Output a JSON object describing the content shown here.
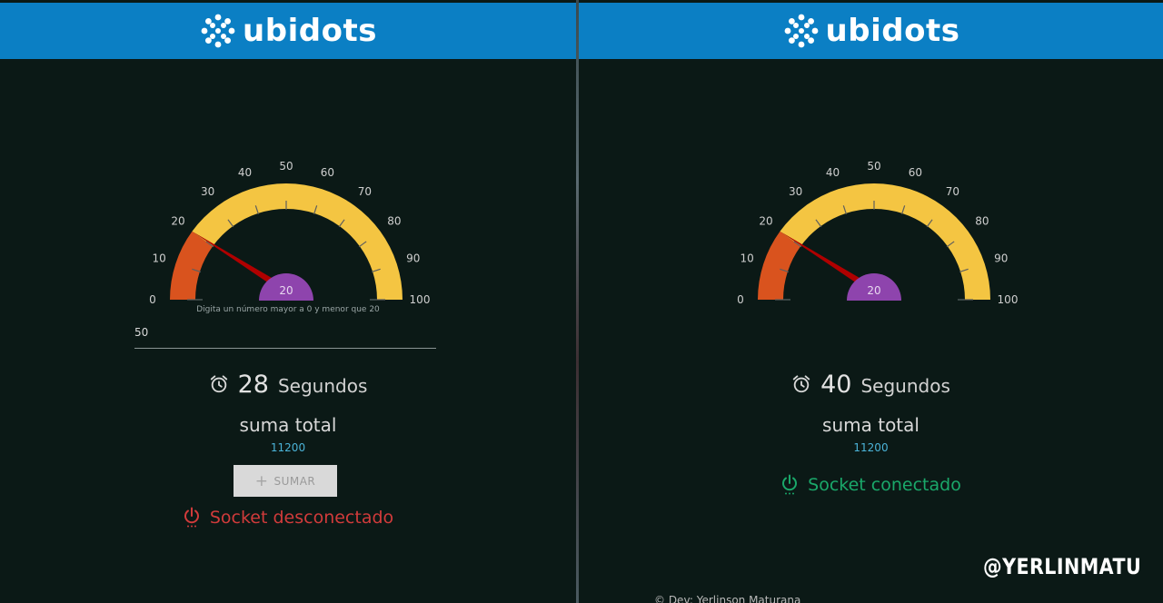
{
  "brand": {
    "name": "ubidots"
  },
  "colors": {
    "header_bg": "#0b7fc4",
    "page_bg": "#0b1916",
    "gauge_low": "#d9531e",
    "gauge_high": "#f4c542",
    "needle": "#b00000",
    "center_hub": "#8e44ad",
    "disconnected": "#d13b3b",
    "connected": "#1aa86a",
    "value_link": "#4bb3d8"
  },
  "gauge_ticks": [
    "0",
    "10",
    "20",
    "30",
    "40",
    "50",
    "60",
    "70",
    "80",
    "90",
    "100"
  ],
  "left": {
    "gauge": {
      "min": 0,
      "max": 100,
      "value": 20,
      "value_label": "20",
      "threshold": 20
    },
    "hint": "Digita un número mayor a 0 y menor que 20",
    "input_value": "50",
    "timer": {
      "icon": "alarm-clock-icon",
      "count": "28",
      "unit": "Segundos"
    },
    "suma_label": "suma total",
    "suma_value": "11200",
    "button": {
      "icon": "+",
      "label": "SUMAR"
    },
    "status": {
      "icon": "power-icon",
      "text": "Socket desconectado"
    }
  },
  "right": {
    "gauge": {
      "min": 0,
      "max": 100,
      "value": 20,
      "value_label": "20",
      "threshold": 20
    },
    "timer": {
      "icon": "alarm-clock-icon",
      "count": "40",
      "unit": "Segundos"
    },
    "suma_label": "suma total",
    "suma_value": "11200",
    "status": {
      "icon": "power-icon",
      "text": "Socket conectado"
    },
    "footer": "© Dev: Yerlinson Maturana"
  },
  "watermark": "@YERLINMATU"
}
